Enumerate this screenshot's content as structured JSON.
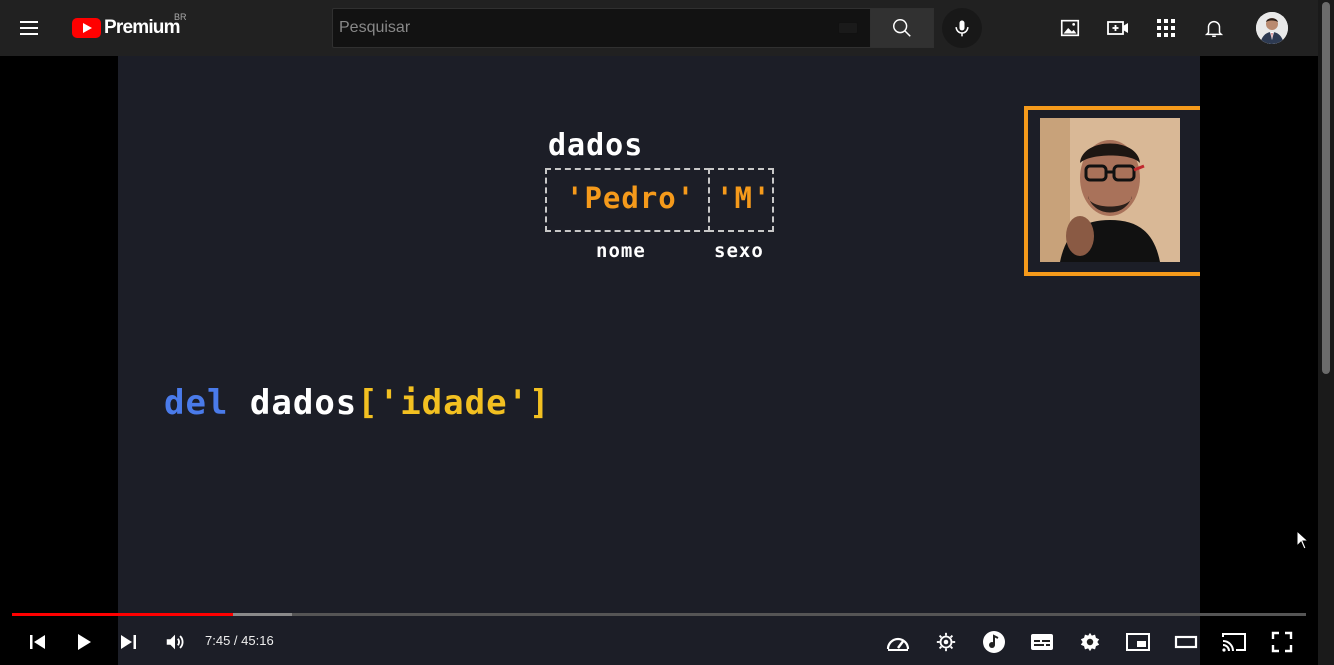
{
  "header": {
    "logo_text": "Premium",
    "logo_region": "BR",
    "search_placeholder": "Pesquisar",
    "icons": [
      "menu-icon",
      "search-icon",
      "mic-icon",
      "image-icon",
      "create-video-icon",
      "apps-icon",
      "bell-icon",
      "avatar"
    ]
  },
  "video": {
    "dict_name": "dados",
    "value_name": "'Pedro'",
    "value_sex": "'M'",
    "key_name": "nome",
    "key_sex": "sexo",
    "code_keyword": "del",
    "code_var": "dados",
    "code_index": "['idade']"
  },
  "player": {
    "current_time": "7:45",
    "total_time": "45:16",
    "time_display": "7:45 / 45:16",
    "progress_fraction": 0.171,
    "buffered_fraction": 0.216,
    "controls": [
      "previous-icon",
      "play-icon",
      "next-icon",
      "volume-icon",
      "speed-icon",
      "sponsor-icon",
      "music-icon",
      "subtitles-icon",
      "settings-icon",
      "miniplayer-icon",
      "theater-icon",
      "cast-icon",
      "fullscreen-icon"
    ]
  },
  "colors": {
    "progress": "#ff0000",
    "keyword": "#4a7bea",
    "value": "#f59a1b",
    "index": "#f2c021",
    "video_bg": "#1c1e27"
  }
}
